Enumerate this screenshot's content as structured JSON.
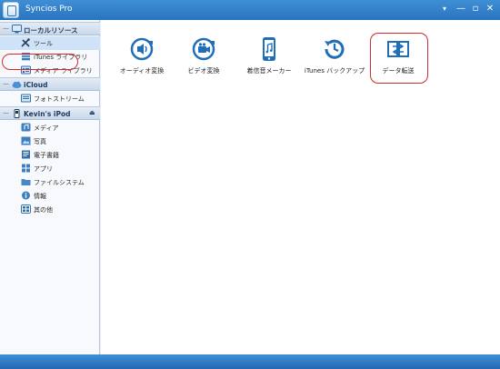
{
  "window": {
    "title": "Syncios Pro"
  },
  "titlebar": {
    "menu_glyph": "▾",
    "min_glyph": "—",
    "max_glyph": "▫",
    "close_glyph": "✕"
  },
  "sidebar": {
    "local": {
      "header": "ローカルリソース",
      "items": [
        {
          "label": "ツール",
          "icon": "tools-icon"
        },
        {
          "label": "iTunes ライブラリ",
          "icon": "itunes-library-icon"
        },
        {
          "label": "メディア ライブラリ",
          "icon": "media-library-icon"
        }
      ]
    },
    "icloud": {
      "header": "iCloud",
      "items": [
        {
          "label": "フォトストリーム",
          "icon": "photostream-icon"
        }
      ]
    },
    "device": {
      "header": "Kevin's iPod",
      "eject_glyph": "⏏",
      "items": [
        {
          "label": "メディア",
          "icon": "media-icon"
        },
        {
          "label": "写真",
          "icon": "photo-icon"
        },
        {
          "label": "電子書籍",
          "icon": "ebook-icon"
        },
        {
          "label": "アプリ",
          "icon": "apps-icon"
        },
        {
          "label": "ファイルシステム",
          "icon": "filesystem-icon"
        },
        {
          "label": "情報",
          "icon": "info-icon"
        },
        {
          "label": "其の他",
          "icon": "others-icon"
        }
      ]
    }
  },
  "main": {
    "tools": [
      {
        "label": "オーディオ変換",
        "icon": "audio-convert-icon"
      },
      {
        "label": "ビデオ変換",
        "icon": "video-convert-icon"
      },
      {
        "label": "着信音メーカー",
        "icon": "ringtone-maker-icon"
      },
      {
        "label": "iTunes バックアップ",
        "icon": "itunes-backup-icon"
      },
      {
        "label": "データ転送",
        "icon": "data-transfer-icon"
      }
    ]
  },
  "colors": {
    "accent": "#2a74bf",
    "highlight": "#d62a2a",
    "icon_blue": "#1f6fb8"
  }
}
